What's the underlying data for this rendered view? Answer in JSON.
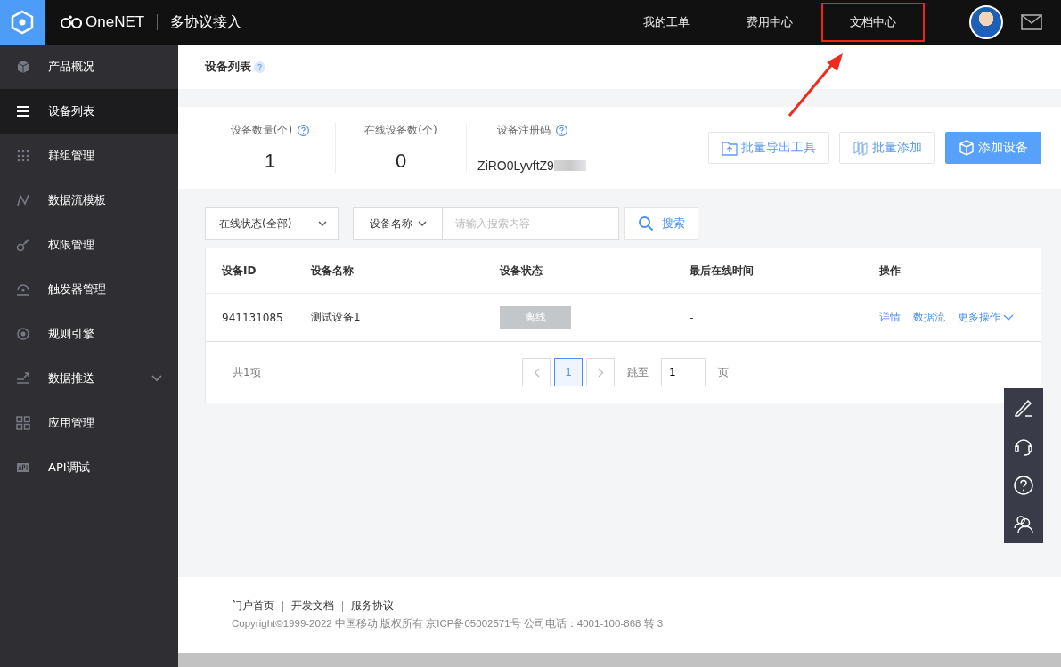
{
  "header": {
    "brand": "OneNET",
    "product": "多协议接入",
    "nav": [
      {
        "label": "我的工单",
        "highlighted": false
      },
      {
        "label": "费用中心",
        "highlighted": false
      },
      {
        "label": "文档中心",
        "highlighted": true
      }
    ]
  },
  "sidebar": {
    "items": [
      {
        "label": "产品概况",
        "selected": false,
        "expandable": false
      },
      {
        "label": "设备列表",
        "selected": true,
        "expandable": false
      },
      {
        "label": "群组管理",
        "selected": false,
        "expandable": false
      },
      {
        "label": "数据流模板",
        "selected": false,
        "expandable": false
      },
      {
        "label": "权限管理",
        "selected": false,
        "expandable": false
      },
      {
        "label": "触发器管理",
        "selected": false,
        "expandable": false
      },
      {
        "label": "规则引擎",
        "selected": false,
        "expandable": false
      },
      {
        "label": "数据推送",
        "selected": false,
        "expandable": true
      },
      {
        "label": "应用管理",
        "selected": false,
        "expandable": false
      },
      {
        "label": "API调试",
        "selected": false,
        "expandable": false
      }
    ]
  },
  "page_title": "设备列表",
  "stats": [
    {
      "label": "设备数量(个)",
      "value": "1",
      "help": true
    },
    {
      "label": "在线设备数(个)",
      "value": "0"
    },
    {
      "label": "设备注册码",
      "value": "ZiRO0LyvftZ9",
      "help": true
    }
  ],
  "actions": [
    {
      "label": "批量导出工具",
      "primary": false
    },
    {
      "label": "批量添加",
      "primary": false
    },
    {
      "label": "添加设备",
      "primary": true
    }
  ],
  "filters": {
    "status": "在线状态(全部)",
    "field": "设备名称",
    "search_placeholder": "请输入搜索内容",
    "search_button": "搜索"
  },
  "table": {
    "columns": [
      "设备ID",
      "设备名称",
      "设备状态",
      "最后在线时间",
      "操作"
    ],
    "rows": [
      {
        "id": "941131085",
        "name": "测试设备1",
        "status": "离线",
        "online": false,
        "last_online": "-",
        "links": [
          "详情",
          "数据流",
          "更多操作"
        ]
      }
    ]
  },
  "pagination": {
    "total": "共1项",
    "pages": [
      {
        "label": "1",
        "selected": true
      }
    ],
    "jump_label": "跳至",
    "jump_value": "1",
    "page_unit": "页"
  },
  "footer": {
    "links": [
      "门户首页",
      "开发文档",
      "服务协议"
    ],
    "copyright": "Copyright©1999-2022 中国移动 版权所有 京ICP备05002571号 公司电话：4001-100-868 转 3"
  }
}
